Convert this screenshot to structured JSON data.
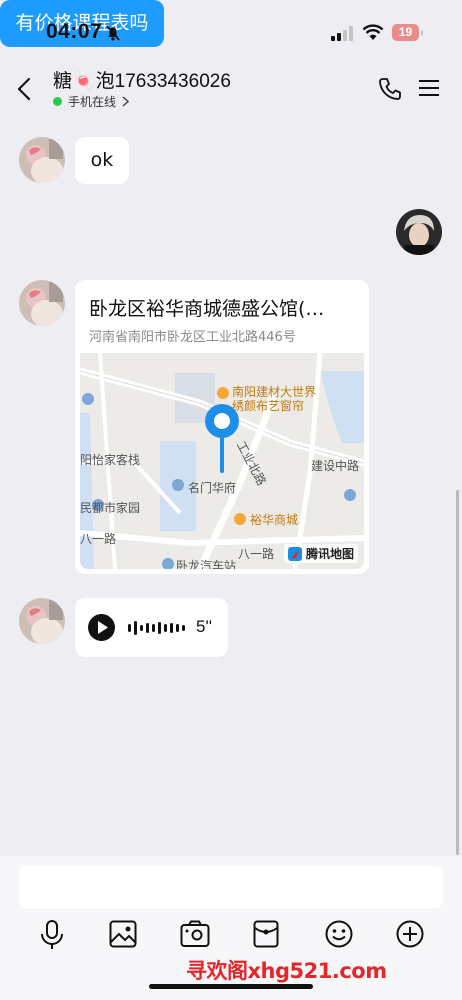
{
  "status": {
    "time": "04:07",
    "battery": "19"
  },
  "header": {
    "title": "糖🍬泡17633436026",
    "subtitle": "手机在线"
  },
  "messages": {
    "incoming_text": "ok",
    "outgoing_text": "有价格课程表吗",
    "location": {
      "title": "卧龙区裕华商城德盛公馆(…",
      "address": "河南省南阳市卧龙区工业北路446号",
      "map_labels": {
        "poi_1a": "南阳建材大世界",
        "poi_1b": "绣颜布艺窗帘",
        "road_gongye": "工业北路",
        "road_jianshe": "建设中路",
        "hotel": "阳怡家客栈",
        "mingmen": "名门华府",
        "minduo": "民都市家园",
        "yuhua": "裕华商城",
        "bayi_left": "八一路",
        "bayi_right": "八一路",
        "wolong_bus": "卧龙汽车站",
        "provider": "腾讯地图"
      }
    },
    "voice": {
      "duration": "5''"
    }
  },
  "watermark": "寻欢阁xhg521.com",
  "colors": {
    "accent": "#1e9bff",
    "online": "#2bc84f",
    "battery_low": "#e98d8b",
    "watermark": "#e5262a"
  },
  "icons": [
    "back-icon",
    "phone-icon",
    "menu-icon",
    "microphone-icon",
    "image-icon",
    "camera-icon",
    "red-packet-icon",
    "emoji-icon",
    "plus-icon",
    "play-icon"
  ]
}
